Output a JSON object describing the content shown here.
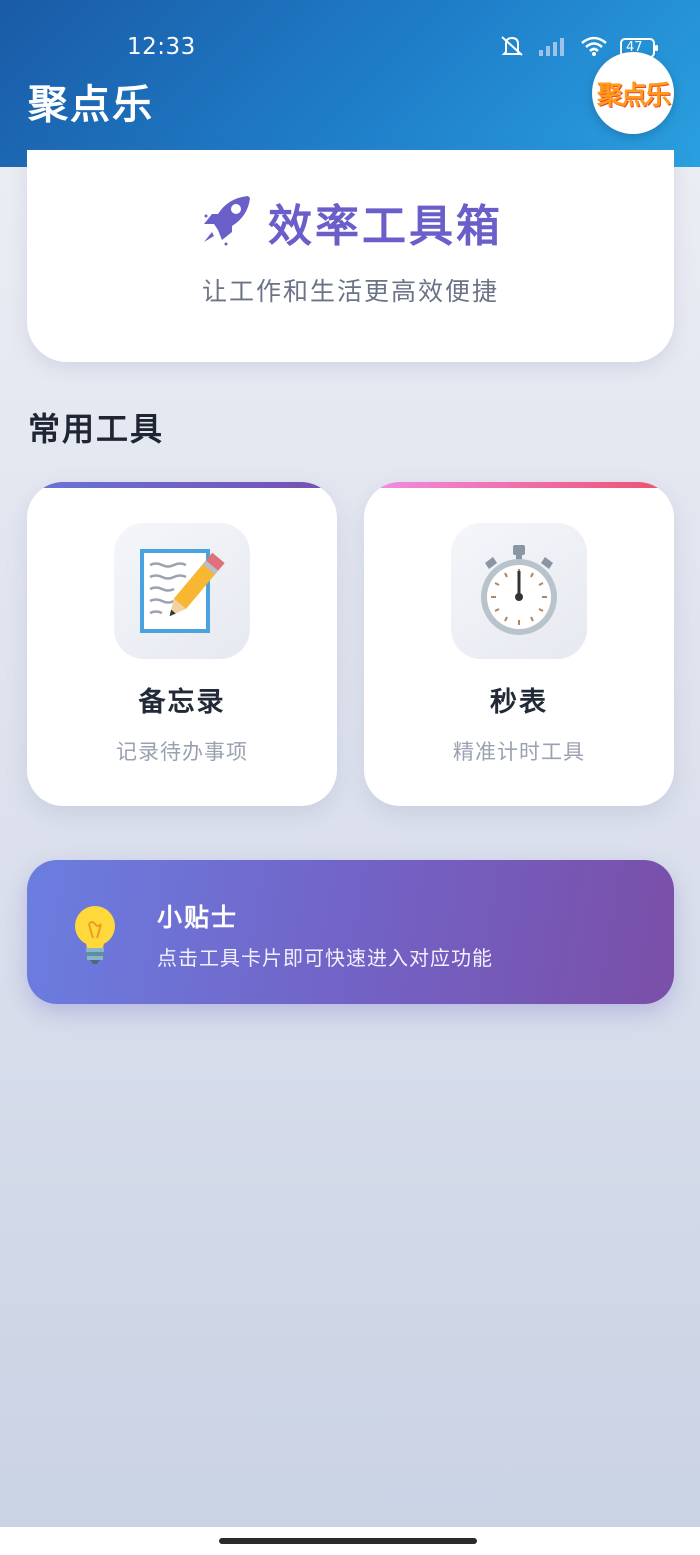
{
  "status_bar": {
    "time": "12:33",
    "battery": "47"
  },
  "header": {
    "title": "聚点乐",
    "logo_text": "聚点乐"
  },
  "hero": {
    "title": "效率工具箱",
    "subtitle": "让工作和生活更高效便捷",
    "icon": "rocket-icon"
  },
  "section": {
    "title": "常用工具"
  },
  "tools": [
    {
      "name": "备忘录",
      "desc": "记录待办事项",
      "icon": "memo-icon",
      "accent_from": "#6a74d6",
      "accent_to": "#7650b0"
    },
    {
      "name": "秒表",
      "desc": "精准计时工具",
      "icon": "stopwatch-icon",
      "accent_from": "#f08ee6",
      "accent_to": "#ef4f6e"
    }
  ],
  "tip": {
    "title": "小贴士",
    "text": "点击工具卡片即可快速进入对应功能",
    "icon": "lightbulb-icon"
  },
  "colors": {
    "header_blue": "#1f7fc9",
    "accent_purple": "#6a5fc9"
  }
}
